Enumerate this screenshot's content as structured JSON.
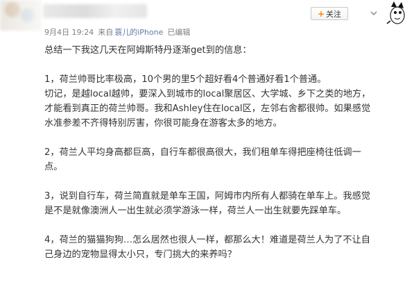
{
  "header": {
    "follow_label": "关注",
    "follow_plus": "+"
  },
  "meta": {
    "time": "9月4日 19:24",
    "from": "来自",
    "device": "蓑儿的iPhone",
    "edited": "已编辑"
  },
  "post": {
    "intro": "总结一下我这几天在阿姆斯特丹逐渐get到的信息：",
    "p1": [
      "1，荷兰帅哥比率极高，10个男的里5个超好看4个普通好看1个普通。",
      "切记，是越local越帅，要深入到城市的local聚居区、大学城、乡下之类的地方，",
      "才能看到真正的荷兰帅哥。我和Ashley住在local区，左邻右舍都很帅。如果感觉",
      "水准参差不齐得特别厉害，你很可能身在游客太多的地方。"
    ],
    "p2": [
      "2，荷兰人平均身高都巨高，自行车都很高很大，我们租单车得把座椅往低调一",
      "点。"
    ],
    "p3": [
      "3，说到自行车，荷兰简直就是单车王国，阿姆市内所有人都骑在单车上。我感觉",
      "是不是就像澳洲人一出生就必须学游泳一样，荷兰人一出生就要先踩单车。"
    ],
    "p4": [
      "4，荷兰的猫猫狗狗…怎么居然也很人一样，都那么大！难道是荷兰人为了不让自",
      "己身边的宠物显得太小只，专门挑大的来养吗？"
    ]
  },
  "icons": {
    "follow": "plus-icon",
    "menu": "chevron-down-icon",
    "mascot": "mascot-icon"
  },
  "colors": {
    "accent": "#ff8200",
    "meta_text": "#808080",
    "link": "#5d7ea8",
    "body_text": "#333333"
  }
}
